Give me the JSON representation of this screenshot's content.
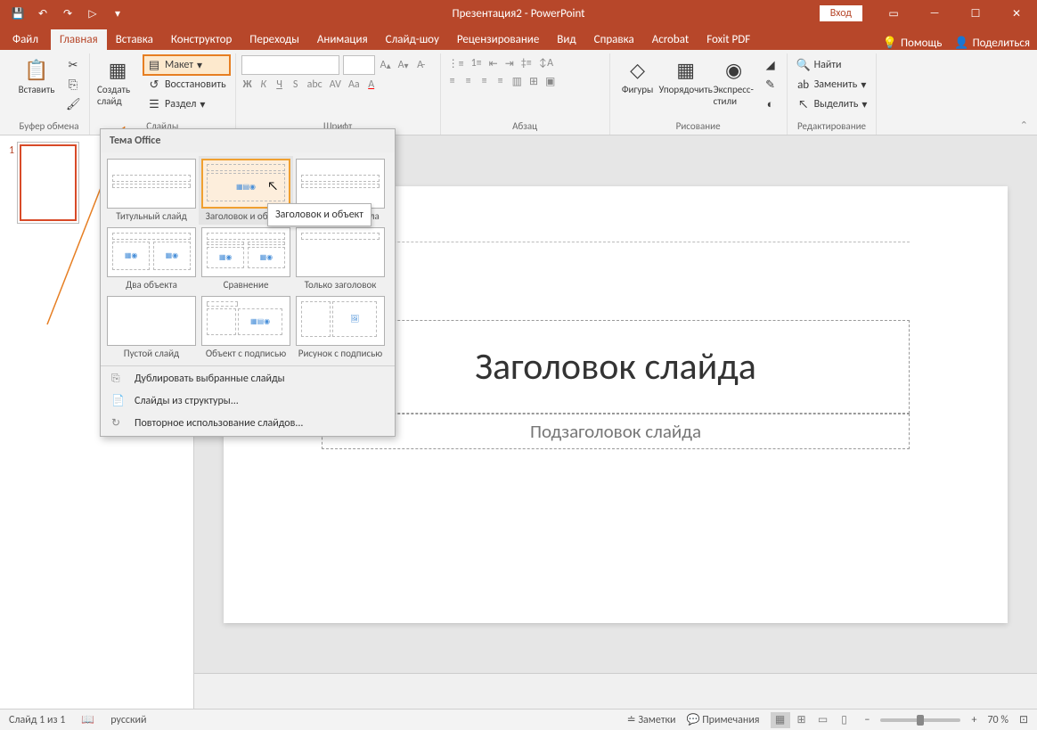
{
  "titlebar": {
    "title": "Презентация2 - PowerPoint",
    "login": "Вход",
    "qat": {
      "save": "💾",
      "undo": "↶",
      "redo": "↷",
      "start": "▷",
      "more": "▾"
    }
  },
  "tabs": {
    "file": "Файл",
    "home": "Главная",
    "insert": "Вставка",
    "design": "Конструктор",
    "transitions": "Переходы",
    "animations": "Анимация",
    "slideshow": "Слайд-шоу",
    "review": "Рецензирование",
    "view": "Вид",
    "help": "Справка",
    "acrobat": "Acrobat",
    "foxit": "Foxit PDF",
    "tellme": "Помощь",
    "share": "Поделиться"
  },
  "groups": {
    "clipboard": {
      "label": "Буфер обмена",
      "paste": "Вставить"
    },
    "slides": {
      "label": "Слайды",
      "new": "Создать слайд",
      "layout": "Макет",
      "reset": "Восстановить",
      "section": "Раздел"
    },
    "font": {
      "label": "Шрифт"
    },
    "paragraph": {
      "label": "Абзац"
    },
    "drawing": {
      "label": "Рисование",
      "shapes": "Фигуры",
      "arrange": "Упорядочить",
      "quick": "Экспресс-стили"
    },
    "editing": {
      "label": "Редактирование",
      "find": "Найти",
      "replace": "Заменить",
      "select": "Выделить"
    }
  },
  "gallery": {
    "header": "Тема Office",
    "layouts": [
      {
        "name": "Титульный слайд",
        "kind": "title"
      },
      {
        "name": "Заголовок и объект",
        "kind": "content"
      },
      {
        "name": "Заголовок раздела",
        "kind": "section"
      },
      {
        "name": "Два объекта",
        "kind": "two"
      },
      {
        "name": "Сравнение",
        "kind": "compare"
      },
      {
        "name": "Только заголовок",
        "kind": "titleonly"
      },
      {
        "name": "Пустой слайд",
        "kind": "blank"
      },
      {
        "name": "Объект с подписью",
        "kind": "objcap"
      },
      {
        "name": "Рисунок с подписью",
        "kind": "piccap"
      }
    ],
    "footer": {
      "duplicate": "Дублировать выбранные слайды",
      "outline": "Слайды из структуры...",
      "reuse": "Повторное использование слайдов..."
    },
    "tooltip": "Заголовок и объект"
  },
  "slide": {
    "title_placeholder": "Заголовок слайда",
    "subtitle_placeholder": "Подзаголовок слайда"
  },
  "thumb": {
    "num": "1"
  },
  "statusbar": {
    "slide_of": "Слайд 1 из 1",
    "lang": "русский",
    "notes": "Заметки",
    "comments": "Примечания",
    "zoom": "70 %"
  }
}
